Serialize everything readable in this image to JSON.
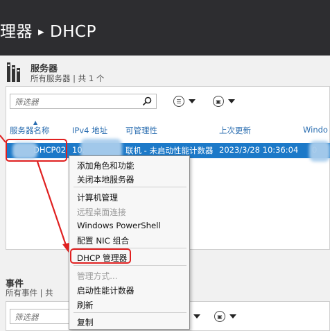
{
  "header": {
    "title_prefix": "理器",
    "separator": "▸",
    "title": "DHCP"
  },
  "servers": {
    "title": "服务器",
    "subtitle": "所有服务器 | 共 1 个",
    "filter_placeholder": "筛选器",
    "columns": [
      "服务器名称",
      "IPv4 地址",
      "可管理性",
      "上次更新",
      "Windo"
    ],
    "selected_row": {
      "name": "DHCP02",
      "ipv4": "10.",
      "manageability": "联机 - 未启动性能计数器",
      "last_update": "2023/3/28 10:36:04",
      "windows": "0"
    }
  },
  "events": {
    "title": "事件",
    "subtitle": "所有事件 | 共",
    "filter_placeholder": "筛选器"
  },
  "context_menu": {
    "items": [
      {
        "label": "添加角色和功能",
        "enabled": true
      },
      {
        "label": "关闭本地服务器",
        "enabled": true
      },
      {
        "label": "计算机管理",
        "enabled": true
      },
      {
        "label": "远程桌面连接",
        "enabled": false
      },
      {
        "label": "Windows PowerShell",
        "enabled": true
      },
      {
        "label": "配置 NIC 组合",
        "enabled": true
      },
      {
        "label": "DHCP 管理器",
        "enabled": true
      },
      {
        "label": "管理方式...",
        "enabled": false
      },
      {
        "label": "启动性能计数器",
        "enabled": true
      },
      {
        "label": "刷新",
        "enabled": true
      },
      {
        "label": "复制",
        "enabled": true
      }
    ]
  },
  "colors": {
    "topbar": "#2d2d30",
    "selection": "#1c79c8",
    "highlight": "#e02020",
    "header_link": "#2a6db0"
  },
  "icons": [
    "server-icon",
    "search-icon",
    "list-view-icon",
    "save-icon",
    "chevron-down-icon",
    "red-arrow-icon"
  ]
}
